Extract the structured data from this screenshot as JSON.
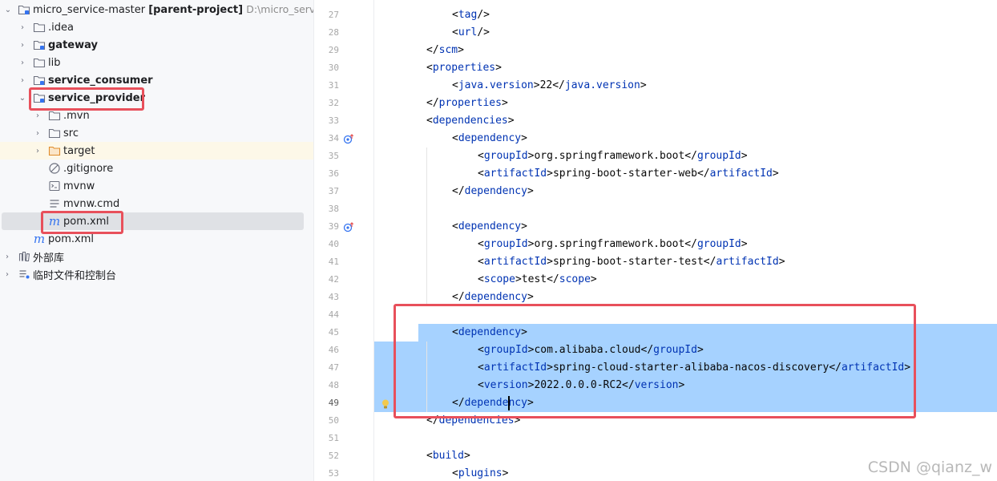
{
  "tree": {
    "root": {
      "name": "micro_service-master",
      "tag": "[parent-project]",
      "path": "D:\\micro_service-"
    },
    "items": [
      {
        "label": ".idea"
      },
      {
        "label": "gateway"
      },
      {
        "label": "lib"
      },
      {
        "label": "service_consumer"
      },
      {
        "label": "service_provider"
      },
      {
        "label": ".mvn"
      },
      {
        "label": "src"
      },
      {
        "label": "target"
      },
      {
        "label": ".gitignore"
      },
      {
        "label": "mvnw"
      },
      {
        "label": "mvnw.cmd"
      },
      {
        "label": "pom.xml"
      },
      {
        "label": "pom.xml"
      },
      {
        "label": "外部库"
      },
      {
        "label": "临时文件和控制台"
      }
    ]
  },
  "editor": {
    "lines": [
      {
        "no": "27",
        "tag": "tag",
        "text": ""
      },
      {
        "no": "28",
        "tag": "url",
        "text": ""
      },
      {
        "no": "29",
        "tag": "scm",
        "text": ""
      },
      {
        "no": "30",
        "tag": "properties",
        "text": ""
      },
      {
        "no": "31",
        "tag": "java.version",
        "text": "22"
      },
      {
        "no": "32",
        "tag": "properties",
        "text": ""
      },
      {
        "no": "33",
        "tag": "dependencies",
        "text": ""
      },
      {
        "no": "34",
        "tag": "dependency",
        "text": ""
      },
      {
        "no": "35",
        "tag": "groupId",
        "text": "org.springframework.boot"
      },
      {
        "no": "36",
        "tag": "artifactId",
        "text": "spring-boot-starter-web"
      },
      {
        "no": "37",
        "tag": "dependency",
        "text": ""
      },
      {
        "no": "38",
        "tag": "",
        "text": ""
      },
      {
        "no": "39",
        "tag": "dependency",
        "text": ""
      },
      {
        "no": "40",
        "tag": "groupId",
        "text": "org.springframework.boot"
      },
      {
        "no": "41",
        "tag": "artifactId",
        "text": "spring-boot-starter-test"
      },
      {
        "no": "42",
        "tag": "scope",
        "text": "test"
      },
      {
        "no": "43",
        "tag": "dependency",
        "text": ""
      },
      {
        "no": "44",
        "tag": "",
        "text": ""
      },
      {
        "no": "45",
        "tag": "dependency",
        "text": ""
      },
      {
        "no": "46",
        "tag": "groupId",
        "text": "com.alibaba.cloud"
      },
      {
        "no": "47",
        "tag": "artifactId",
        "text": "spring-cloud-starter-alibaba-nacos-discovery"
      },
      {
        "no": "48",
        "tag": "version",
        "text": "2022.0.0.0-RC2"
      },
      {
        "no": "49",
        "tag": "dependency",
        "text": ""
      },
      {
        "no": "50",
        "tag": "dependencies",
        "text": ""
      },
      {
        "no": "51",
        "tag": "",
        "text": ""
      },
      {
        "no": "52",
        "tag": "build",
        "text": ""
      },
      {
        "no": "53",
        "tag": "plugins",
        "text": ""
      }
    ]
  },
  "watermark": "CSDN @qianz_w",
  "colors": {
    "tag": "#0033b3",
    "selection": "#a6d2ff",
    "annotation_box": "#e8505b",
    "sidebar_bg": "#f7f8fa"
  }
}
